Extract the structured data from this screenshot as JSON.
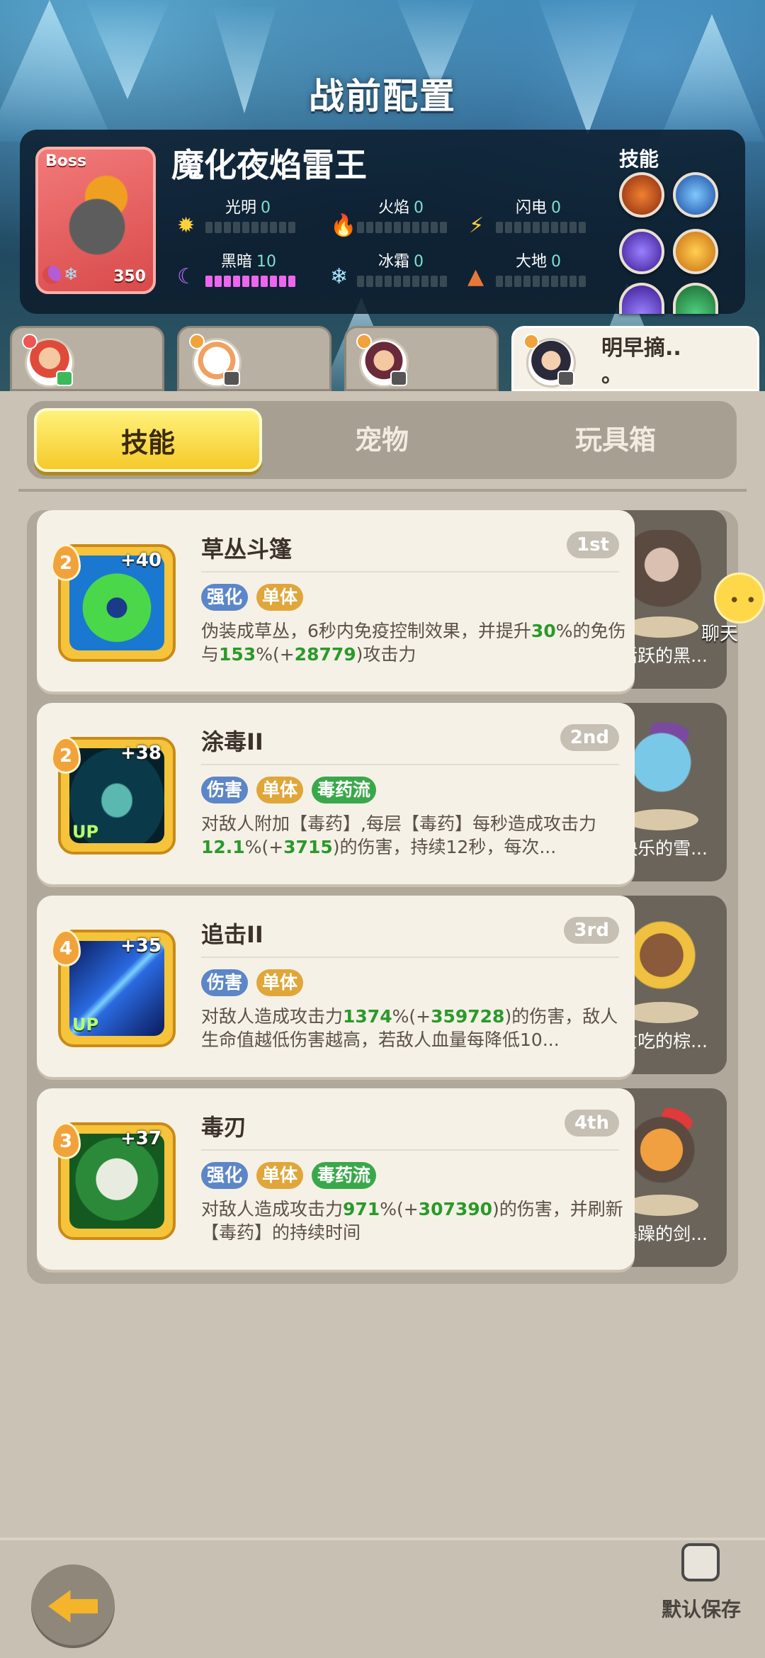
{
  "screen_title": "战前配置",
  "boss": {
    "tag": "Boss",
    "name": "魔化夜焰雷王",
    "level": "350",
    "skills_title": "技能",
    "elements": [
      {
        "name": "光明",
        "value": "0",
        "level": 0
      },
      {
        "name": "火焰",
        "value": "0",
        "level": 0
      },
      {
        "name": "闪电",
        "value": "0",
        "level": 0
      },
      {
        "name": "黑暗",
        "value": "10",
        "level": 10
      },
      {
        "name": "冰霜",
        "value": "0",
        "level": 0
      },
      {
        "name": "大地",
        "value": "0",
        "level": 0
      }
    ]
  },
  "hero_tabs": [
    {
      "name": ""
    },
    {
      "name": ""
    },
    {
      "name": ""
    },
    {
      "name": "明早摘..\n。"
    }
  ],
  "segments": [
    "技能",
    "宠物",
    "玩具箱"
  ],
  "skills": [
    {
      "title": "草丛斗篷",
      "rank": "1st",
      "level": "2",
      "plus": "+40",
      "up": "",
      "tags": [
        "强化",
        "单体"
      ],
      "desc_parts": [
        {
          "t": "伪装成草丛，6秒内免疫控制效果，并提升"
        },
        {
          "t": "30",
          "hl": true
        },
        {
          "t": "%的免伤与"
        },
        {
          "t": "153",
          "hl": true
        },
        {
          "t": "%(+"
        },
        {
          "t": "28779",
          "hl": true
        },
        {
          "t": ")攻击力"
        }
      ],
      "pet_name": "活跃的黑..."
    },
    {
      "title": "涂毒II",
      "rank": "2nd",
      "level": "2",
      "plus": "+38",
      "up": "UP",
      "tags": [
        "伤害",
        "单体",
        "毒药流"
      ],
      "desc_parts": [
        {
          "t": "对敌人附加【毒药】,每层【毒药】每秒造成攻击力"
        },
        {
          "t": "12.1",
          "hl": true
        },
        {
          "t": "%(+"
        },
        {
          "t": "3715",
          "hl": true
        },
        {
          "t": ")的伤害，持续12秒，每次..."
        }
      ],
      "pet_name": "快乐的雪..."
    },
    {
      "title": "追击II",
      "rank": "3rd",
      "level": "4",
      "plus": "+35",
      "up": "UP",
      "tags": [
        "伤害",
        "单体"
      ],
      "desc_parts": [
        {
          "t": "对敌人造成攻击力"
        },
        {
          "t": "1374",
          "hl": true
        },
        {
          "t": "%(+"
        },
        {
          "t": "359728",
          "hl": true
        },
        {
          "t": ")的伤害，敌人生命值越低伤害越高，若敌人血量每降低10..."
        }
      ],
      "pet_name": "贪吃的棕..."
    },
    {
      "title": "毒刃",
      "rank": "4th",
      "level": "3",
      "plus": "+37",
      "up": "",
      "tags": [
        "强化",
        "单体",
        "毒药流"
      ],
      "desc_parts": [
        {
          "t": "对敌人造成攻击力"
        },
        {
          "t": "971",
          "hl": true
        },
        {
          "t": "%(+"
        },
        {
          "t": "307390",
          "hl": true
        },
        {
          "t": ")的伤害，并刷新【毒药】的持续时间"
        }
      ],
      "pet_name": "暴躁的剑..."
    }
  ],
  "chat_label": "聊天",
  "save_label": "默认保存",
  "colors": {
    "accent_yellow": "#f5c92a",
    "highlight_green": "#2a9a2a",
    "tag_blue": "#5c86c8",
    "tag_gold": "#e0a63a",
    "tag_green": "#3aa84a"
  }
}
